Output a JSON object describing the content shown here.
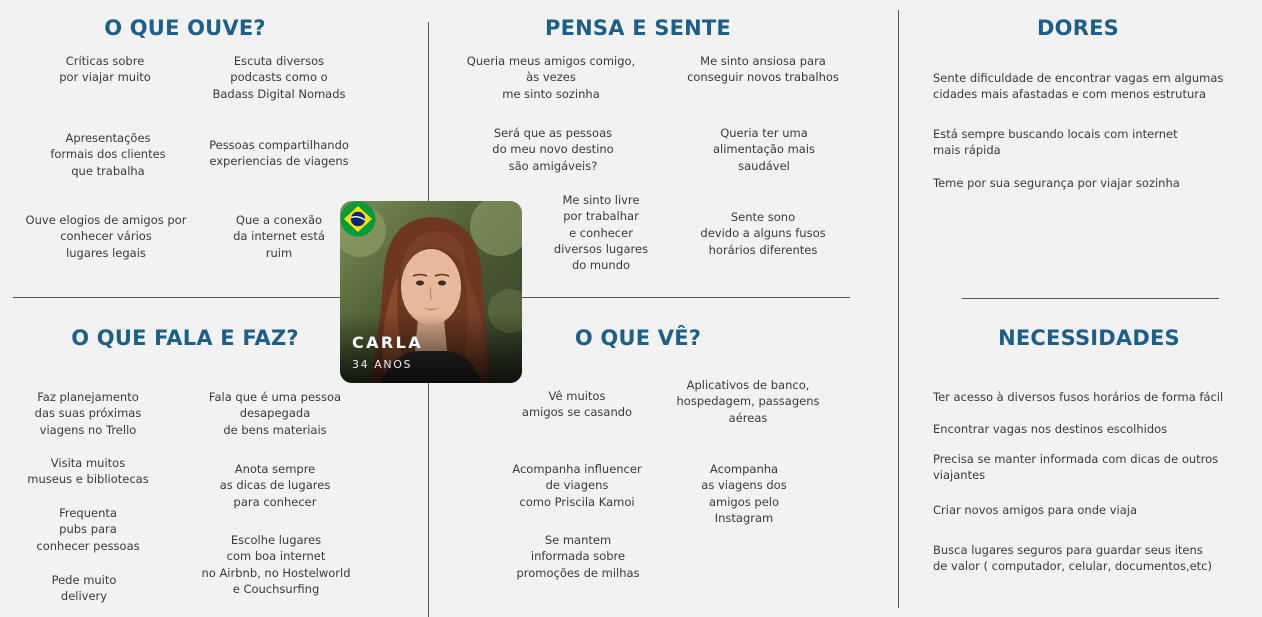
{
  "sections": {
    "ouve": {
      "title": "O QUE OUVE?",
      "notes": [
        "Críticas sobre\npor viajar muito",
        "Escuta diversos\npodcasts como o\nBadass Digital Nomads",
        "Apresentações\nformais dos clientes\nque trabalha",
        "Pessoas compartilhando\nexperiencias de viagens",
        "Ouve elogios de amigos por\nconhecer vários\nlugares legais",
        "Que a conexão\nda internet está\nruim"
      ]
    },
    "pensa": {
      "title": "PENSA E SENTE",
      "notes": [
        "Queria meus amigos comigo,\nàs vezes\nme sinto sozinha",
        "Me sinto ansiosa para\nconseguir novos trabalhos",
        "Será que as pessoas\ndo meu novo destino\nsão amigáveis?",
        "Queria ter uma\nalimentação mais\nsaudável",
        "Me sinto livre\npor trabalhar\ne conhecer\ndiversos lugares\ndo mundo",
        "Sente sono\ndevido a alguns fusos\nhorários diferentes"
      ]
    },
    "dores": {
      "title": "DORES",
      "notes": [
        "Sente dificuldade  de encontrar vagas em algumas\ncidades mais afastadas e com menos estrutura",
        "Está sempre buscando locais com internet\nmais rápida",
        "Teme por sua segurança por viajar sozinha"
      ]
    },
    "fala": {
      "title": "O QUE FALA E FAZ?",
      "notes": [
        "Faz planejamento\ndas suas próximas\nviagens no Trello",
        "Fala que é uma pessoa\ndesapegada\nde bens materiais",
        "Visita muitos\nmuseus e bibliotecas",
        "Anota sempre\nas dicas de lugares\npara conhecer",
        "Frequenta\npubs para\nconhecer pessoas",
        "Escolhe lugares\ncom boa internet\nno Airbnb, no Hostelworld\ne Couchsurfing",
        "Pede muito\ndelivery"
      ]
    },
    "ve": {
      "title": "O QUE VÊ?",
      "notes": [
        "Vê muitos\namigos se casando",
        "Aplicativos de banco,\nhospedagem, passagens\naéreas",
        "Acompanha influencer\nde viagens\ncomo Priscila Kamoi",
        "Acompanha\nas viagens dos\namigos pelo\nInstagram",
        "Se mantem\ninformada sobre\npromoções de milhas"
      ]
    },
    "necessidades": {
      "title": "NECESSIDADES",
      "notes": [
        "Ter acesso à  diversos fusos horários de forma fácil",
        "Encontrar vagas nos destinos escolhidos",
        "Precisa se manter informada com dicas de outros\nviajantes",
        "Criar novos amigos para onde viaja",
        "Busca lugares seguros para guardar seus itens\nde valor ( computador, celular, documentos,etc)"
      ]
    }
  },
  "persona": {
    "name": "CARLA",
    "age": "34 ANOS",
    "flag_icon": "brazil-flag-icon",
    "colors": {
      "flag_green": "#009c3b",
      "flag_yellow": "#ffdf00",
      "flag_blue": "#002776"
    }
  },
  "colors": {
    "title": "#1e5f8a",
    "text": "#3a3a3a",
    "background": "#f2f2f2",
    "lines": "#555555"
  }
}
